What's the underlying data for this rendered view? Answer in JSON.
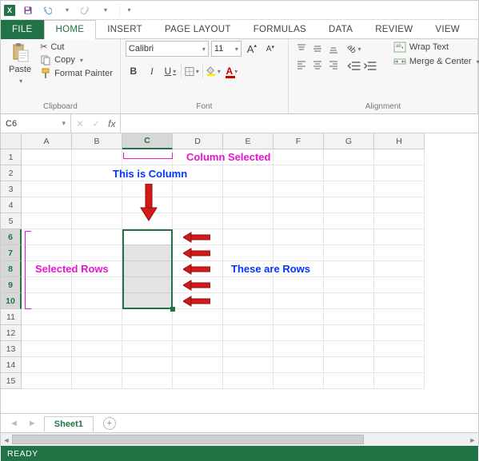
{
  "qat": {
    "icon": "X"
  },
  "tabs": {
    "file": "FILE",
    "home": "HOME",
    "insert": "INSERT",
    "page_layout": "PAGE LAYOUT",
    "formulas": "FORMULAS",
    "data": "DATA",
    "review": "REVIEW",
    "view": "VIEW"
  },
  "ribbon": {
    "clipboard": {
      "paste": "Paste",
      "cut": "Cut",
      "copy": "Copy",
      "format_painter": "Format Painter",
      "group": "Clipboard"
    },
    "font": {
      "name": "Calibri",
      "size": "11",
      "group": "Font",
      "bold": "B",
      "italic": "I",
      "underline": "U",
      "grow": "A",
      "shrink": "A"
    },
    "alignment": {
      "wrap": "Wrap Text",
      "merge": "Merge & Center",
      "group": "Alignment"
    }
  },
  "namebox": "C6",
  "columns": [
    "A",
    "B",
    "C",
    "D",
    "E",
    "F",
    "G",
    "H"
  ],
  "rows": [
    "1",
    "2",
    "3",
    "4",
    "5",
    "6",
    "7",
    "8",
    "9",
    "10",
    "11",
    "12",
    "13",
    "14",
    "15"
  ],
  "selected_col_index": 2,
  "selected_row_start": 5,
  "selected_row_end": 9,
  "annotations": {
    "column_selected": "Column Selected",
    "this_is_column": "This is Column",
    "selected_rows": "Selected Rows",
    "these_are_rows": "These are Rows"
  },
  "sheet_tab": "Sheet1",
  "status": "READY"
}
